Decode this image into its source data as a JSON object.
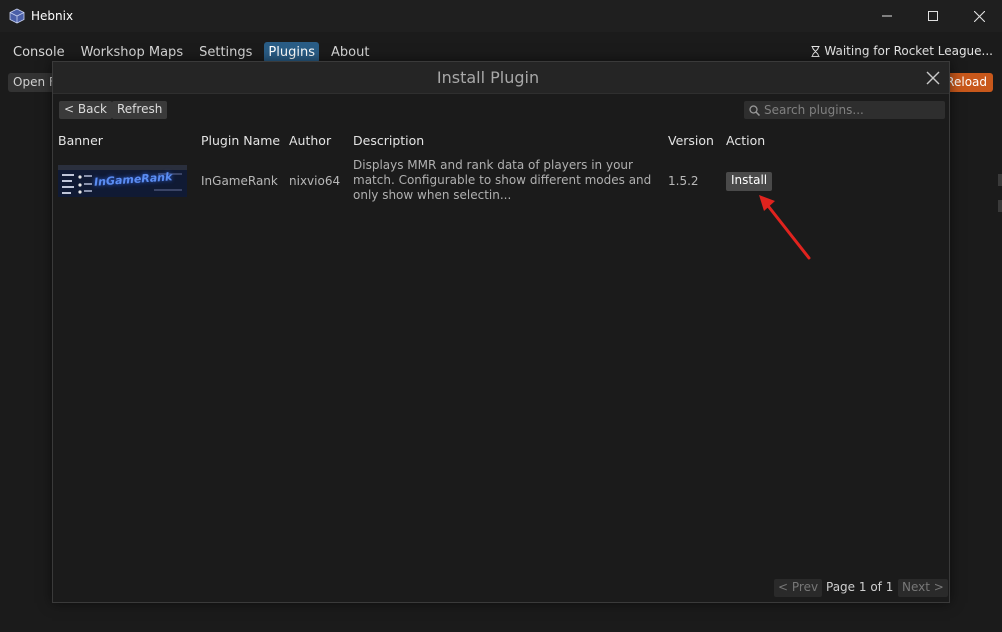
{
  "window": {
    "title": "Hebnix",
    "icon": "cube-icon"
  },
  "menu": {
    "items": [
      {
        "label": "Console"
      },
      {
        "label": "Workshop Maps"
      },
      {
        "label": "Settings"
      },
      {
        "label": "Plugins"
      },
      {
        "label": "About"
      }
    ],
    "active_index": 3,
    "status": "Waiting for Rocket League..."
  },
  "background": {
    "open_label": "Open F",
    "reload_label": "Reload",
    "reload_color": "#c8581b"
  },
  "modal": {
    "title": "Install Plugin",
    "back_label": "< Back",
    "refresh_label": "Refresh",
    "search_placeholder": "Search plugins...",
    "columns": {
      "banner": "Banner",
      "name": "Plugin Name",
      "author": "Author",
      "description": "Description",
      "version": "Version",
      "action": "Action"
    },
    "rows": [
      {
        "banner_text": "InGameRank",
        "name": "InGameRank",
        "author": "nixvio64",
        "description": "Displays MMR and rank data of players in your match. Configurable to show different modes and only show when selectin...",
        "version": "1.5.2",
        "action_label": "Install"
      }
    ],
    "pager": {
      "prev_label": "< Prev",
      "page_info": "Page 1 of 1",
      "next_label": "Next >"
    }
  },
  "colors": {
    "accent": "#2a5d86",
    "annotation_arrow": "#e0231e"
  }
}
